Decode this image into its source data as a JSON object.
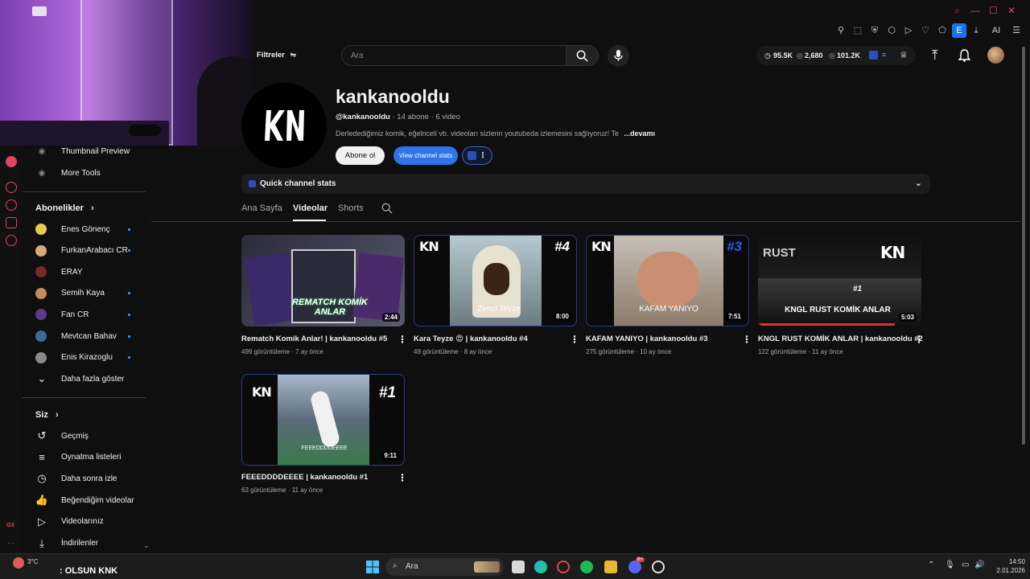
{
  "browser": {
    "window_controls": [
      "search",
      "minimize",
      "maximize",
      "close"
    ],
    "ai_label": "AI",
    "extension_badge": "E"
  },
  "header": {
    "filters_label": "Filtreler",
    "search_placeholder": "Ara",
    "stats": {
      "views": "95.5K",
      "likes": "2,680",
      "subs": "101.2K"
    }
  },
  "sidebar": {
    "tools": [
      {
        "label": "Thumbnail Preview"
      },
      {
        "label": "More Tools"
      }
    ],
    "subscriptions_heading": "Abonelikler",
    "subscriptions": [
      {
        "label": "Enes Gönenç",
        "color": "#e8c94a",
        "dot": true
      },
      {
        "label": "FurkanArabacı CR",
        "color": "#d9a87a",
        "dot": true
      },
      {
        "label": "ERAY",
        "color": "#7a2a2a",
        "dot": false
      },
      {
        "label": "Semih Kaya",
        "color": "#c48a5a",
        "dot": true
      },
      {
        "label": "Fan CR",
        "color": "#5a3a8a",
        "dot": true
      },
      {
        "label": "Mevtcan Bahav",
        "color": "#3a6a9a",
        "dot": true
      },
      {
        "label": "Enis Kirazoglu",
        "color": "#8a8a8a",
        "dot": true
      }
    ],
    "show_more": "Daha fazla göster",
    "you_heading": "Siz",
    "you_items": [
      {
        "label": "Geçmiş",
        "icon": "history-icon"
      },
      {
        "label": "Oynatma listeleri",
        "icon": "playlist-icon"
      },
      {
        "label": "Daha sonra izle",
        "icon": "clock-icon"
      },
      {
        "label": "Beğendiğim videolar",
        "icon": "thumb-up-icon"
      },
      {
        "label": "Videolarınız",
        "icon": "video-icon"
      },
      {
        "label": "İndirilenler",
        "icon": "download-icon"
      }
    ]
  },
  "channel": {
    "name": "kankanooldu",
    "handle": "@kankanooldu",
    "meta": " · 14 abone · 6 video",
    "description": "Derledediğimiz komik, eğelnceli vb. videoları sizlerin youtubeda izlemesini sağlıyoruz! Te",
    "more": "...devamı",
    "subscribe": "Abone ol",
    "view_stats": "View channel stats",
    "quick_stats": "Quick channel stats"
  },
  "tabs": [
    {
      "label": "Ana Sayfa",
      "active": false
    },
    {
      "label": "Videolar",
      "active": true
    },
    {
      "label": "Shorts",
      "active": false
    }
  ],
  "videos": [
    {
      "title": "Rematch Komik Anlar! | kankanooldu #5",
      "views": "499 görüntüleme",
      "age": "7 ay önce",
      "duration": "2:44",
      "overlay": "REMATCH KOMİK ANLAR",
      "rank": ""
    },
    {
      "title": "Kara Teyze 😍 | kankanooldu #4",
      "views": "49 görüntüleme",
      "age": "8 ay önce",
      "duration": "8:00",
      "overlay": "Zenci Teyze",
      "rank": "#4"
    },
    {
      "title": "KAFAM YANIYO | kankanooldu #3",
      "views": "275 görüntüleme",
      "age": "10 ay önce",
      "duration": "7:51",
      "overlay": "KAFAM YANIYO",
      "rank": "#3"
    },
    {
      "title": "KNGL RUST KOMİK ANLAR | kankanooldu #2",
      "views": "122 görüntüleme",
      "age": "11 ay önce",
      "duration": "5:03",
      "overlay": "KNGL RUST KOMİK ANLAR",
      "rank": "#1"
    },
    {
      "title": "FEEEDDDDEEEE | kankanooldu #1",
      "views": "63 görüntüleme",
      "age": "11 ay önce",
      "duration": "9:11",
      "overlay": "FEEEDDDDEEEE",
      "rank": "#1"
    }
  ],
  "video_meta_sep": " · ",
  "taskbar": {
    "weather_temp": "3°C",
    "ticker": ": OLSUN KNK",
    "search": "Ara",
    "time": "14:50",
    "date": "2.01.2026",
    "discord_badge": "9+"
  }
}
